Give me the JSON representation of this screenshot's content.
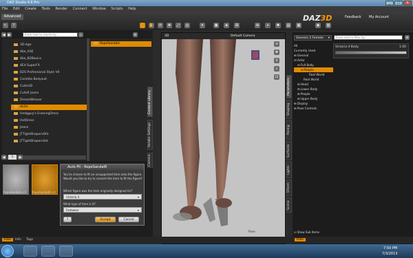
{
  "window": {
    "title": "DAZ Studio 4.6 Pro"
  },
  "menu": [
    "File",
    "Edit",
    "Create",
    "Tools",
    "Render",
    "Connect",
    "Window",
    "Scripts",
    "Help"
  ],
  "tabs": {
    "advanced": "Advanced"
  },
  "header_links": {
    "feedback": "Feedback",
    "account": "My Account"
  },
  "logo": {
    "text": "DAZ",
    "suffix": "3D"
  },
  "content_library": {
    "search_placeholder": "Enter text to search by...",
    "folders": [
      "3D-Age",
      "4be_ASE",
      "4be_B2Basics",
      "4Ed SuperFX",
      "B2S Professional Style V4",
      "Carlotta Bodysuit",
      "Cutie3D",
      "CutoR Jeans",
      "DreamWeaver",
      "ds3d",
      "Hedgguy's EveningDress",
      "HotDress",
      "Jeans",
      "JTTightShapersOfa",
      "JTTightShapersSet"
    ],
    "selected_folder": "ds3d",
    "subfolder": "RopeSandals",
    "page": "1",
    "thumbnails": [
      {
        "label": "RopeSandalL.cr2",
        "selected": false
      },
      {
        "label": "RopeSandalR.cr2",
        "selected": true
      }
    ],
    "bottom_tabs": [
      "Files",
      "Info",
      "Tags"
    ]
  },
  "left_vtabs": [
    "Content Library",
    "Render Settings",
    "Camera"
  ],
  "dialog": {
    "title": "Auto-Fit : RopeSandalR",
    "line1": "You've chosen to fit an unsupported item onto the figure.",
    "line2": "Would you like to try to convert the item to fit the figure?",
    "q_figure": "Which figure was the item originally designed for?",
    "figure_value": "Victoria 4",
    "q_type": "What type of item is it?",
    "type_value": "Footwear",
    "help_label": "?",
    "accept_label": "Accept",
    "cancel_label": "Cancel"
  },
  "viewport": {
    "camera": "Default Camera",
    "label": "3D",
    "footer": "Pane"
  },
  "right_vtabs": [
    "Parameters",
    "Shaping",
    "Posing",
    "Surfaces",
    "Lights",
    "DForm",
    "Scene"
  ],
  "parameters": {
    "figure": "Genesis 2 Female",
    "filter_placeholder": "Enter text to filter by...",
    "tree": [
      {
        "label": "All",
        "level": 0,
        "style": "normal"
      },
      {
        "label": "Currently Used",
        "level": 0,
        "style": "normal"
      },
      {
        "label": "General",
        "level": 0,
        "style": "normal"
      },
      {
        "label": "Actor",
        "level": 0,
        "style": "normal"
      },
      {
        "label": "Full Body",
        "level": 1,
        "style": "normal"
      },
      {
        "label": "People",
        "level": 2,
        "style": "sel"
      },
      {
        "label": "Real World",
        "level": 3,
        "style": "normal"
      },
      {
        "label": "Real World",
        "level": 2,
        "style": "normal"
      },
      {
        "label": "Head",
        "level": 1,
        "style": "normal"
      },
      {
        "label": "Lower Body",
        "level": 1,
        "style": "normal"
      },
      {
        "label": "People",
        "level": 1,
        "style": "normal"
      },
      {
        "label": "Upper Body",
        "level": 1,
        "style": "normal"
      },
      {
        "label": "Display",
        "level": 0,
        "style": "normal"
      },
      {
        "label": "Pose Controls",
        "level": 0,
        "style": "normal"
      }
    ],
    "slider": {
      "name": "Victoria 4 Body",
      "value": "1.00",
      "fraction": 1.0
    },
    "show_sub_items": "Show Sub Items",
    "footer_tab": "Files"
  },
  "taskbar": {
    "time": "7:50 PM",
    "date": "7/3/2013"
  }
}
